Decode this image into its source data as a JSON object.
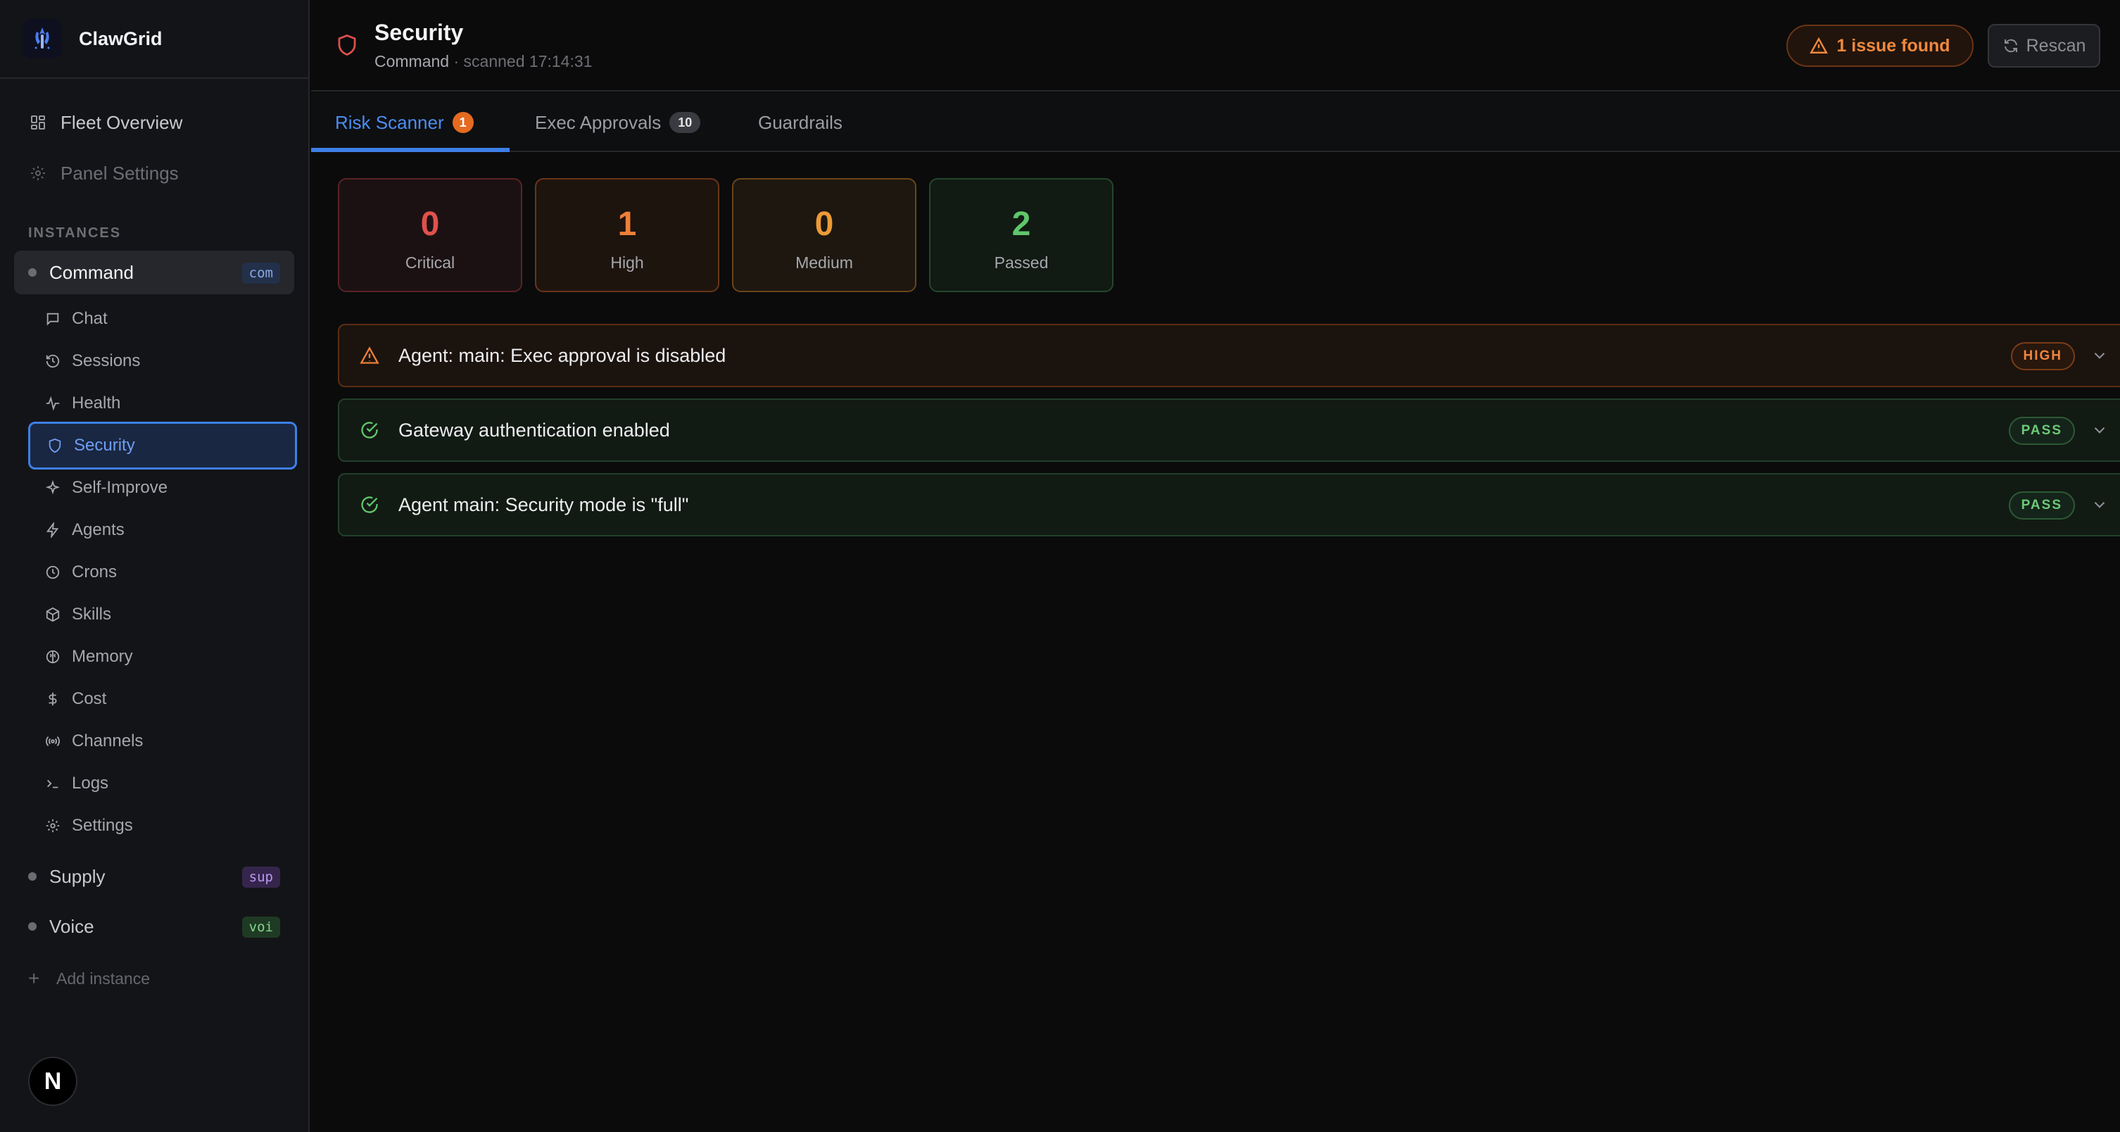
{
  "app": {
    "name": "ClawGrid"
  },
  "nav": {
    "fleet_overview": "Fleet Overview",
    "panel_settings": "Panel Settings",
    "instances_label": "INSTANCES",
    "add_instance": "Add instance"
  },
  "instances": [
    {
      "name": "Command",
      "tag": "com"
    },
    {
      "name": "Supply",
      "tag": "sup"
    },
    {
      "name": "Voice",
      "tag": "voi"
    }
  ],
  "submenu": [
    {
      "label": "Chat",
      "icon": "chat-icon"
    },
    {
      "label": "Sessions",
      "icon": "history-icon"
    },
    {
      "label": "Health",
      "icon": "activity-icon"
    },
    {
      "label": "Security",
      "icon": "shield-icon",
      "active": true
    },
    {
      "label": "Self-Improve",
      "icon": "sparkle-icon"
    },
    {
      "label": "Agents",
      "icon": "bolt-icon"
    },
    {
      "label": "Crons",
      "icon": "clock-icon"
    },
    {
      "label": "Skills",
      "icon": "package-icon"
    },
    {
      "label": "Memory",
      "icon": "brain-icon"
    },
    {
      "label": "Cost",
      "icon": "dollar-icon"
    },
    {
      "label": "Channels",
      "icon": "radio-icon"
    },
    {
      "label": "Logs",
      "icon": "terminal-icon"
    },
    {
      "label": "Settings",
      "icon": "gear-icon"
    }
  ],
  "avatar": {
    "letter": "N"
  },
  "header": {
    "title": "Security",
    "instance": "Command",
    "scanned": " · scanned 17:14:31",
    "issues_button": "1 issue found",
    "rescan_button": "Rescan"
  },
  "tabs": [
    {
      "label": "Risk Scanner",
      "badge": "1"
    },
    {
      "label": "Exec Approvals",
      "badge": "10"
    },
    {
      "label": "Guardrails"
    }
  ],
  "stats": [
    {
      "value": "0",
      "label": "Critical"
    },
    {
      "value": "1",
      "label": "High"
    },
    {
      "value": "0",
      "label": "Medium"
    },
    {
      "value": "2",
      "label": "Passed"
    }
  ],
  "findings": [
    {
      "text": "Agent: main: Exec approval is disabled",
      "severity": "HIGH"
    },
    {
      "text": "Gateway authentication enabled",
      "severity": "PASS"
    },
    {
      "text": "Agent main: Security mode is \"full\"",
      "severity": "PASS"
    }
  ],
  "colors": {
    "accent": "#3d7fe8",
    "high": "#ee7f38",
    "critical": "#e0514c",
    "medium": "#ec9a38",
    "pass": "#5fc66a"
  }
}
